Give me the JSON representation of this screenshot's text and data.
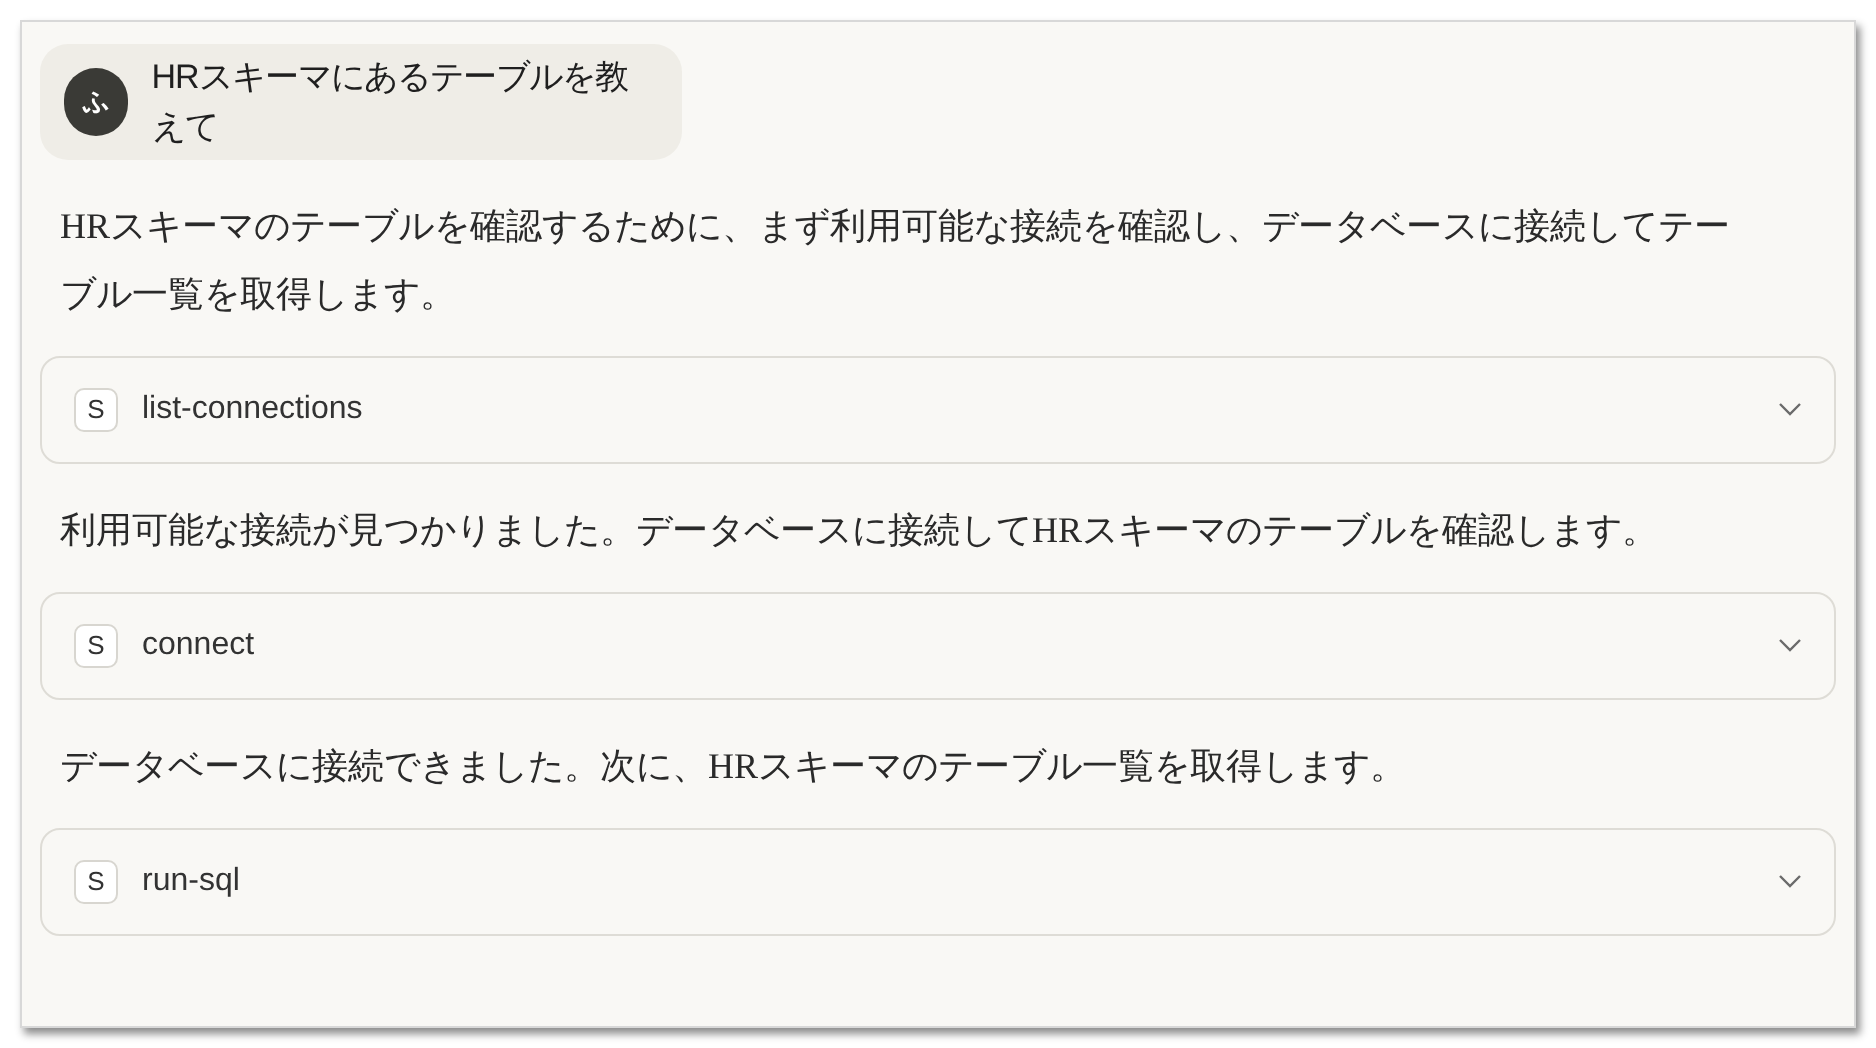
{
  "user_message": {
    "avatar": "ふ",
    "text": "HRスキーマにあるテーブルを教えて"
  },
  "messages": [
    {
      "kind": "text",
      "text": "HRスキーマのテーブルを確認するために、まず利用可能な接続を確認し、データベースに接続してテーブル一覧を取得します。"
    },
    {
      "kind": "tool",
      "badge": "S",
      "name": "list-connections",
      "expanded": false
    },
    {
      "kind": "text",
      "text": "利用可能な接続が見つかりました。データベースに接続してHRスキーマのテーブルを確認します。"
    },
    {
      "kind": "tool",
      "badge": "S",
      "name": "connect",
      "expanded": false
    },
    {
      "kind": "text",
      "text": "データベースに接続できました。次に、HRスキーマのテーブル一覧を取得します。"
    },
    {
      "kind": "tool",
      "badge": "S",
      "name": "run-sql",
      "expanded": false
    }
  ]
}
